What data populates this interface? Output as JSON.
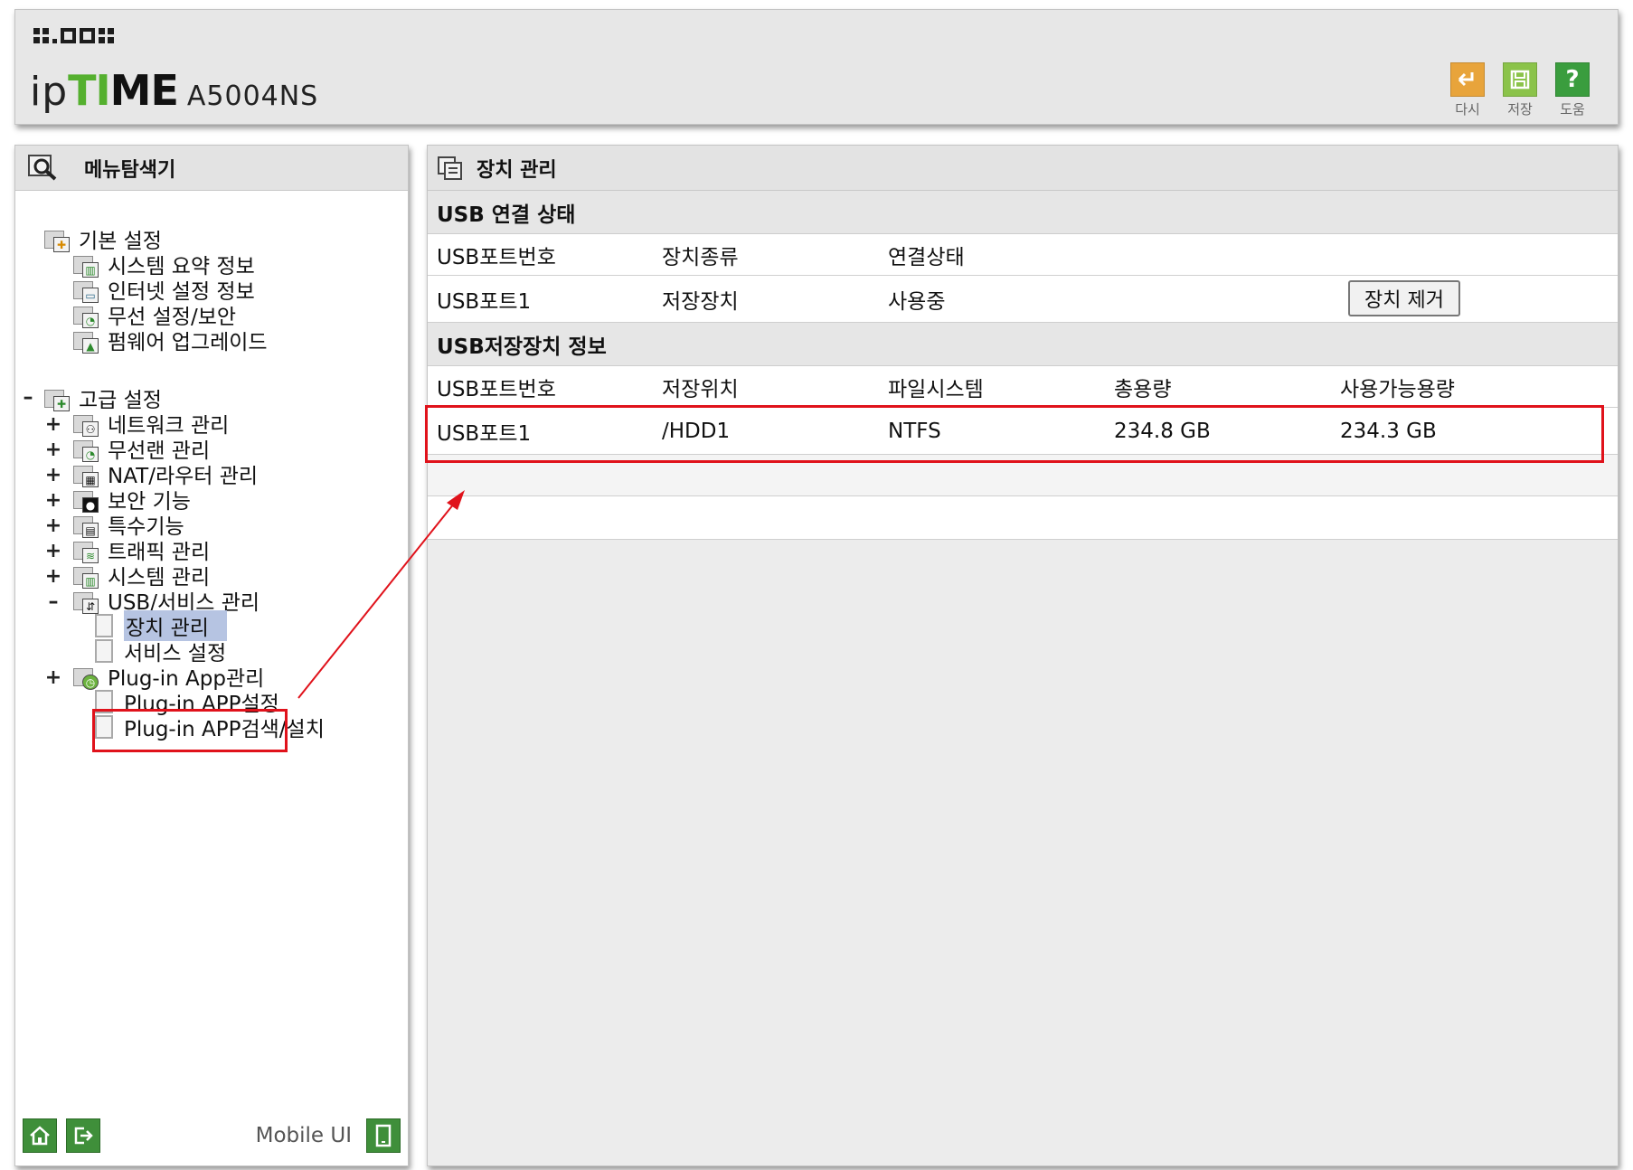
{
  "header": {
    "model": "A5004NS",
    "toolbar": {
      "reset_label": "다시",
      "save_label": "저장",
      "help_label": "도움"
    },
    "colors": {
      "reset": "#e8a43b",
      "save": "#8bc34a",
      "help": "#3a9d3e",
      "logo_accent": "#55b02f"
    }
  },
  "sidebar": {
    "title": "메뉴탐색기",
    "basic": {
      "label": "기본 설정",
      "items": [
        "시스템 요약 정보",
        "인터넷 설정 정보",
        "무선 설정/보안",
        "펌웨어 업그레이드"
      ]
    },
    "advanced": {
      "label": "고급 설정",
      "items": [
        "네트워크 관리",
        "무선랜 관리",
        "NAT/라우터 관리",
        "보안 기능",
        "특수기능",
        "트래픽 관리",
        "시스템 관리"
      ],
      "usb": {
        "label": "USB/서비스 관리",
        "items": [
          "장치 관리",
          "서비스 설정"
        ],
        "selected": "장치 관리"
      },
      "plugin": {
        "label": "Plug-in App관리",
        "items": [
          "Plug-in APP설정",
          "Plug-in APP검색/설치"
        ]
      }
    },
    "footer": {
      "mobile_label": "Mobile UI"
    }
  },
  "main": {
    "title": "장치 관리",
    "usb_status": {
      "heading": "USB 연결 상태",
      "columns": [
        "USB포트번호",
        "장치종류",
        "연결상태"
      ],
      "rows": [
        {
          "port": "USB포트1",
          "type": "저장장치",
          "status": "사용중",
          "action": "장치 제거"
        }
      ]
    },
    "storage_info": {
      "heading": "USB저장장치 정보",
      "columns": [
        "USB포트번호",
        "저장위치",
        "파일시스템",
        "총용량",
        "사용가능용량"
      ],
      "rows": [
        {
          "port": "USB포트1",
          "location": "/HDD1",
          "fs": "NTFS",
          "total": "234.8 GB",
          "available": "234.3 GB"
        }
      ]
    }
  },
  "annotation_color": "#e0121b"
}
